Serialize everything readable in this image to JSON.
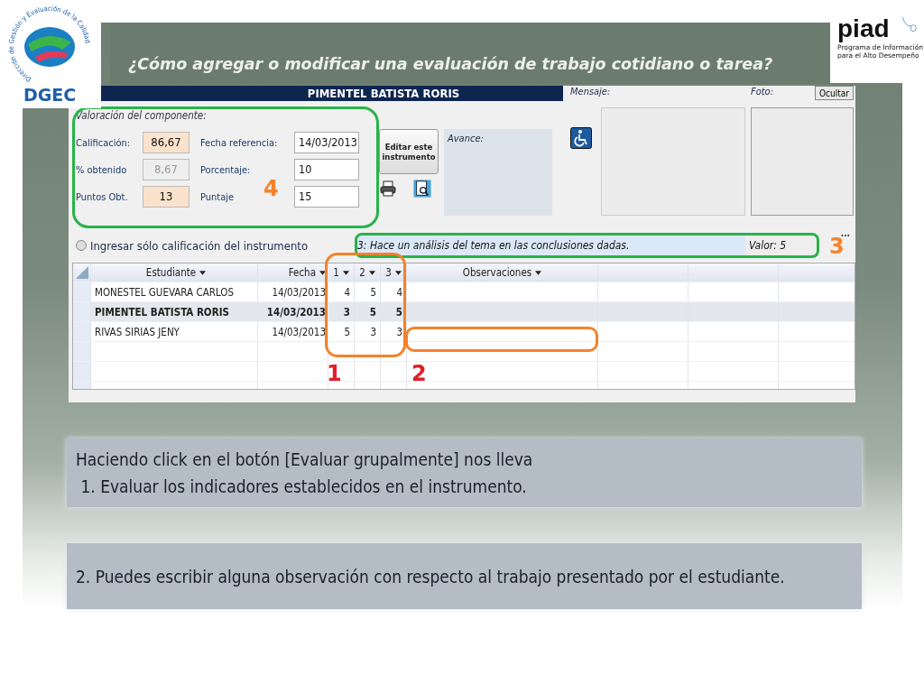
{
  "logo_left": {
    "name": "DGEC",
    "arc_text": "Dirección de Gestión y Evaluación de la Calidad"
  },
  "logo_right": {
    "name": "piad",
    "subtitle": [
      "Programa de Información",
      "para el Alto Desempeño"
    ]
  },
  "title": "¿Cómo  agregar o modificar  una evaluación de trabajo cotidiano o tarea?",
  "app": {
    "student_header": "PIMENTEL BATISTA RORIS",
    "group_title": "Valoración del componente:",
    "left_fields": [
      {
        "label": "Calificación:",
        "value": "86,67",
        "disabled": false
      },
      {
        "label": "% obtenido",
        "value": "8,67",
        "disabled": true
      },
      {
        "label": "Puntos Obt.",
        "value": "13",
        "disabled": false
      }
    ],
    "right_fields": [
      {
        "label": "Fecha referencia:",
        "value": "14/03/2013"
      },
      {
        "label": "Porcentaje:",
        "value": "10"
      },
      {
        "label": "Puntaje",
        "value": "15"
      }
    ],
    "edit_button": "Editar este instrumento",
    "avance_label": "Avance:",
    "mensaje_label": "Mensaje:",
    "foto_label": "Foto:",
    "hide_button": "Ocultar",
    "radio": {
      "label": "Ingresar sólo calificación del instrumento",
      "checked": false
    },
    "criterion": "3: Hace un análisis del tema en las conclusiones dadas.",
    "criterion_value": "Valor: 5",
    "more": "...",
    "table": {
      "columns": [
        "Estudiante",
        "Fecha",
        "1",
        "2",
        "3",
        "Observaciones"
      ],
      "rows": [
        {
          "cells": [
            "MONESTEL GUEVARA CARLOS",
            "14/03/2013",
            "4",
            "5",
            "4",
            ""
          ],
          "selected": false
        },
        {
          "cells": [
            "PIMENTEL BATISTA RORIS",
            "14/03/2013",
            "3",
            "5",
            "5",
            ""
          ],
          "selected": true
        },
        {
          "cells": [
            "RIVAS SIRIAS JENY",
            "14/03/2013",
            "5",
            "3",
            "3",
            ""
          ],
          "selected": false
        }
      ]
    }
  },
  "annotations": [
    {
      "kind": "group",
      "number": "4",
      "color": "#29b34a"
    },
    {
      "kind": "criterion",
      "number": "3",
      "color": "#29b34a"
    },
    {
      "kind": "scores",
      "number": "1",
      "color": "#f5822a"
    },
    {
      "kind": "observations",
      "number": "2",
      "color": "#f5822a"
    }
  ],
  "notes": [
    [
      "Haciendo click en el botón [Evaluar grupalmente] nos lleva",
      " 1. Evaluar los indicadores establecidos en el instrumento."
    ],
    [
      "2. Puedes escribir alguna observación con respecto al trabajo presentado por el estudiante."
    ]
  ]
}
